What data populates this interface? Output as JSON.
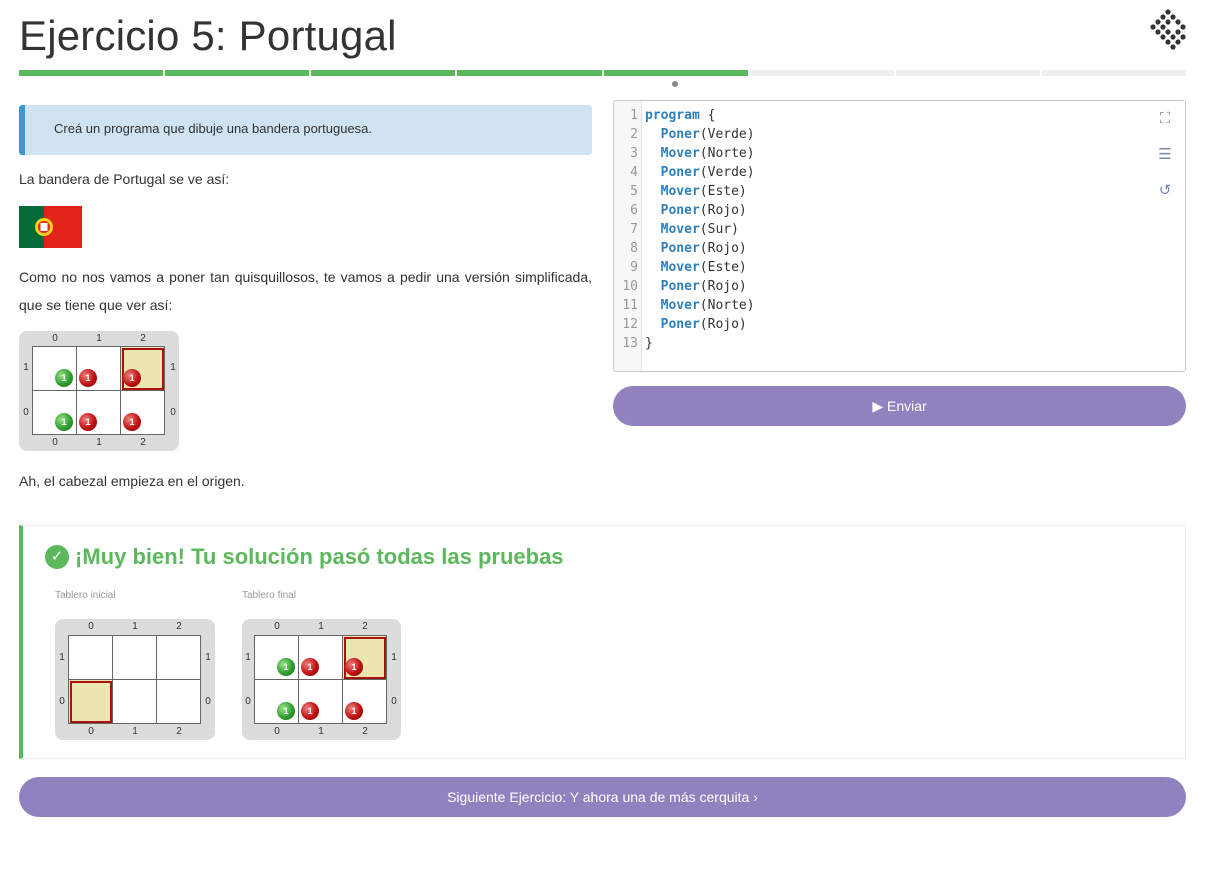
{
  "header": {
    "title": "Ejercicio 5: Portugal"
  },
  "progress": {
    "segments": 8,
    "completed": 5,
    "current": 5
  },
  "statement": {
    "callout": "Creá un programa que dibuje una bandera portuguesa.",
    "intro": "La bandera de Portugal se ve así:",
    "simplified": "Como no nos vamos a poner tan quisquillosos, te vamos a pedir una versión simplificada, que se tiene que ver así:",
    "note": "Ah, el cabezal empieza en el origen."
  },
  "boards": {
    "columns": [
      "0",
      "1",
      "2"
    ],
    "rows": [
      "1",
      "0"
    ],
    "ball_count": "1"
  },
  "editor": {
    "line_numbers": [
      "1",
      "2",
      "3",
      "4",
      "5",
      "6",
      "7",
      "8",
      "9",
      "10",
      "11",
      "12",
      "13"
    ],
    "lines": [
      {
        "kw": "program",
        "rest": " {"
      },
      {
        "kw": "  Poner",
        "rest": "(Verde)"
      },
      {
        "kw": "  Mover",
        "rest": "(Norte)"
      },
      {
        "kw": "  Poner",
        "rest": "(Verde)"
      },
      {
        "kw": "  Mover",
        "rest": "(Este)"
      },
      {
        "kw": "  Poner",
        "rest": "(Rojo)"
      },
      {
        "kw": "  Mover",
        "rest": "(Sur)"
      },
      {
        "kw": "  Poner",
        "rest": "(Rojo)"
      },
      {
        "kw": "  Mover",
        "rest": "(Este)"
      },
      {
        "kw": "  Poner",
        "rest": "(Rojo)"
      },
      {
        "kw": "  Mover",
        "rest": "(Norte)"
      },
      {
        "kw": "  Poner",
        "rest": "(Rojo)"
      },
      {
        "kw": "",
        "rest": "}"
      }
    ]
  },
  "buttons": {
    "submit": "Enviar",
    "next": "Siguiente Ejercicio: Y ahora una de más cerquita"
  },
  "result": {
    "title": "¡Muy bien! Tu solución pasó todas las pruebas",
    "initial_caption": "Tablero inicial",
    "final_caption": "Tablero final"
  },
  "colors": {
    "accent": "#9182bf",
    "success": "#5cb85c",
    "callout": "#cfe3f3",
    "keyword": "#2f7fbd"
  }
}
